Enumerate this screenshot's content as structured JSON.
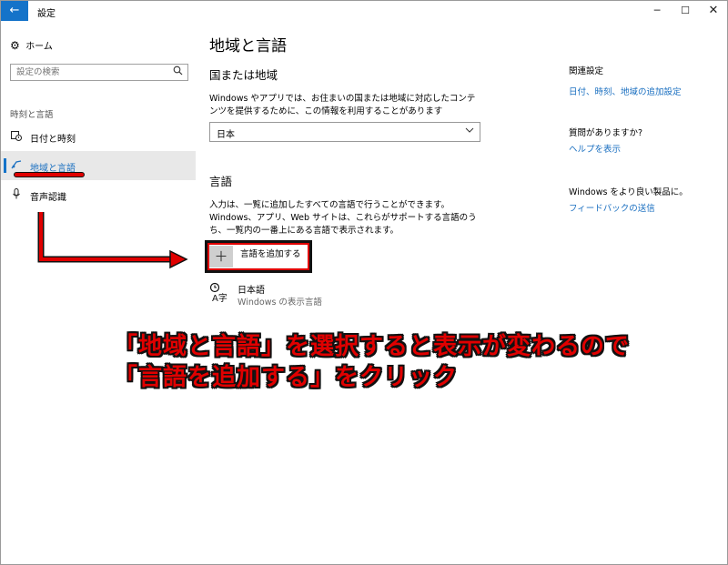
{
  "window": {
    "title": "設定",
    "back_icon": "←",
    "minimize_icon": "─",
    "maximize_icon": "☐",
    "close_icon": "✕"
  },
  "sidebar": {
    "home_label": "ホーム",
    "search_placeholder": "設定の検索",
    "section_label": "時刻と言語",
    "items": [
      {
        "label": "日付と時刻",
        "icon": "calendar-clock-icon",
        "selected": false
      },
      {
        "label": "地域と言語",
        "icon": "region-language-icon",
        "selected": true
      },
      {
        "label": "音声認識",
        "icon": "microphone-icon",
        "selected": false
      }
    ]
  },
  "main": {
    "page_title": "地域と言語",
    "country_heading": "国または地域",
    "country_desc": "Windows やアプリでは、お住まいの国または地域に対応したコンテンツを提供するために、この情報を利用することがあります",
    "country_value": "日本",
    "language_heading": "言語",
    "language_desc": "入力は、一覧に追加したすべての言語で行うことができます。Windows、アプリ、Web サイトは、これらがサポートする言語のうち、一覧内の一番上にある言語で表示されます。",
    "add_language_label": "言語を追加する",
    "add_language_icon": "＋",
    "languages": [
      {
        "name": "日本語",
        "sub": "Windows の表示言語"
      }
    ]
  },
  "related": {
    "related_heading": "関連設定",
    "related_link": "日付、時刻、地域の追加設定",
    "question_heading": "質問がありますか?",
    "help_link": "ヘルプを表示",
    "improve_heading": "Windows をより良い製品に。",
    "feedback_link": "フィードバックの送信"
  },
  "annotation": {
    "line1": "「地域と言語」を選択すると表示が変わるので",
    "line2": "「言語を追加する」をクリック",
    "color": "#e00000"
  },
  "colors": {
    "accent": "#1473c9",
    "link": "#1a6fc0",
    "selected_bg": "#e8e8e8",
    "annotation_red": "#e00000"
  }
}
